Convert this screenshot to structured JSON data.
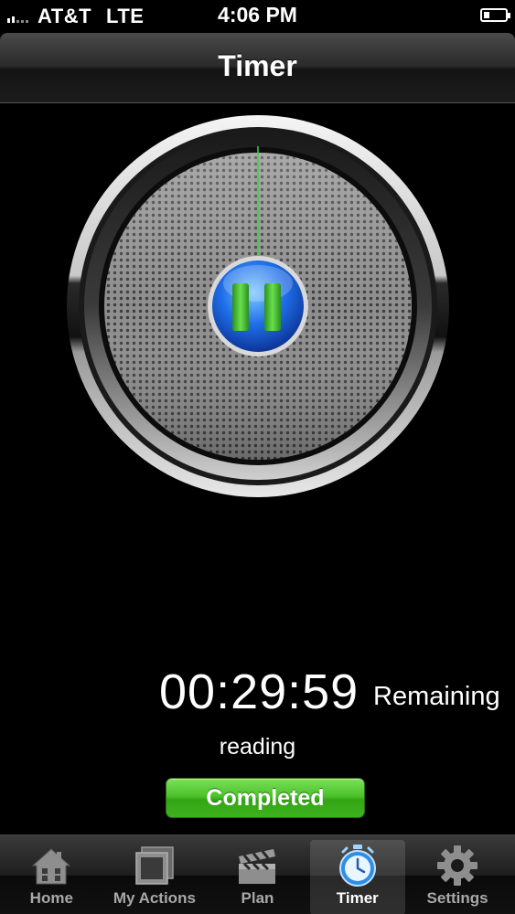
{
  "status_bar": {
    "carrier": "AT&T",
    "network": "LTE",
    "time": "4:06 PM"
  },
  "nav": {
    "title": "Timer"
  },
  "timer": {
    "time_value": "00:29:59",
    "remaining_label": "Remaining",
    "task_name": "reading",
    "completed_button": "Completed"
  },
  "tabs": [
    {
      "label": "Home",
      "icon": "home-icon",
      "selected": false
    },
    {
      "label": "My Actions",
      "icon": "my-actions-icon",
      "selected": false
    },
    {
      "label": "Plan",
      "icon": "clapperboard-icon",
      "selected": false
    },
    {
      "label": "Timer",
      "icon": "stopwatch-icon",
      "selected": true
    },
    {
      "label": "Settings",
      "icon": "gear-icon",
      "selected": false
    }
  ],
  "colors": {
    "completed_green": "#3db21d",
    "pause_blue": "#1f6ee8",
    "pause_green": "#3fbf2a",
    "dial_hand": "#39d04a"
  }
}
